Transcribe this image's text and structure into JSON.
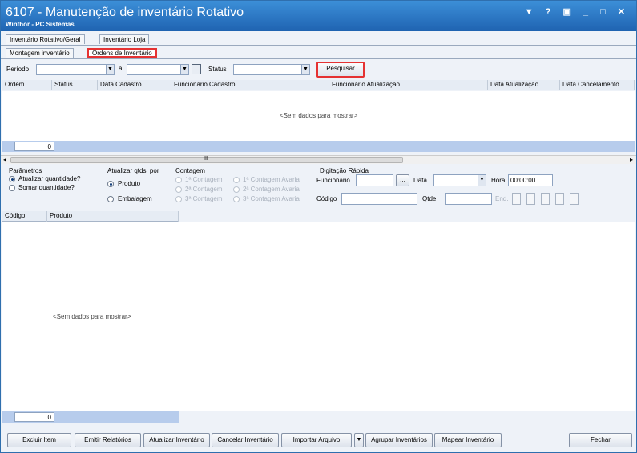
{
  "window": {
    "title": "6107 - Manutenção de inventário Rotativo",
    "subtitle": "Winthor - PC Sistemas",
    "controls": "▼ ? ▣ _ □ ✕"
  },
  "tabs_top": [
    "Inventário Rotativo/Geral",
    "Inventário Loja"
  ],
  "tabs_sub": [
    "Montagem inventário",
    "Ordens de Inventário"
  ],
  "filter": {
    "periodo_label": "Período",
    "a_label": "à",
    "status_label": "Status",
    "pesquisar": "Pesquisar"
  },
  "grid1": {
    "columns": [
      "Ordem",
      "Status",
      "Data Cadastro",
      "Funcionário Cadastro",
      "Funcionário Atualização",
      "Data Atualização",
      "Data Cancelamento"
    ],
    "empty": "<Sem dados para mostrar>",
    "count": "0",
    "scroll_mark": "III"
  },
  "params": {
    "parametros_label": "Parâmetros",
    "atualizar_quantidade": "Atualizar quantidade?",
    "somar_quantidade": "Somar quantidade?",
    "atualizar_qtds_label": "Atualizar qtds. por",
    "produto": "Produto",
    "embalagem": "Embalagem",
    "contagem_label": "Contagem",
    "contagens": [
      "1ª Contagem",
      "1ª Contagem Avaria",
      "2ª Contagem",
      "2ª Contagem Avaria",
      "3ª Contagem",
      "3ª Contagem Avaria"
    ],
    "digitacao_label": "Digitação Rápida",
    "funcionario_label": "Funcionário",
    "data_label": "Data",
    "hora_label": "Hora",
    "hora_value": "00:00:00",
    "codigo_label": "Código",
    "qtde_label": "Qtde.",
    "end_label": "End."
  },
  "grid2": {
    "columns": [
      "Código",
      "Produto"
    ],
    "empty": "<Sem dados para mostrar>",
    "count": "0"
  },
  "buttons": {
    "excluir": "Excluir Item",
    "emitir": "Emitir Relatórios",
    "atualizar": "Atualizar Inventário",
    "cancelar": "Cancelar Inventário",
    "importar": "Importar Arquivo",
    "agrupar": "Agrupar Inventários",
    "mapear": "Mapear Inventário",
    "fechar": "Fechar"
  }
}
